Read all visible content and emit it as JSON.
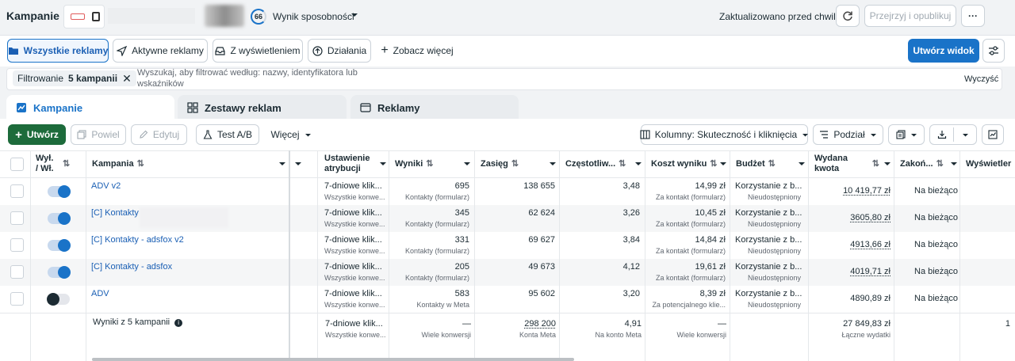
{
  "header": {
    "title": "Kampanie",
    "opportunity_score": "66",
    "opportunity_label": "Wynik sposobności",
    "updated": "Zaktualizowano przed chwilą",
    "review_publish": "Przejrzyj i opublikuj",
    "more": "···"
  },
  "quick_filters": {
    "all_ads": "Wszystkie reklamy",
    "active_ads": "Aktywne reklamy",
    "with_impressions": "Z wyświetleniem",
    "actions": "Działania",
    "see_more": "Zobacz więcej",
    "create_view": "Utwórz widok"
  },
  "filter": {
    "chip_prefix": "Filtrowanie",
    "chip_value": "5 kampanii",
    "search_placeholder": "Wyszukaj, aby filtrować według: nazwy, identyfikatora lub wskaźników",
    "clear": "Wyczyść"
  },
  "tabs": [
    "Kampanie",
    "Zestawy reklam",
    "Reklamy"
  ],
  "toolbar": {
    "create": "Utwórz",
    "duplicate": "Powiel",
    "edit": "Edytuj",
    "ab_test": "Test A/B",
    "more": "Więcej",
    "columns": "Kolumny: Skuteczność i kliknięcia",
    "breakdown": "Podział"
  },
  "columns": {
    "onoff": "Wył. / Wł.",
    "campaign": "Kampania",
    "attribution": "Ustawienie atrybucji",
    "results": "Wyniki",
    "reach": "Zasięg",
    "frequency": "Częstotliw...",
    "cost_per_result": "Koszt wyniku",
    "budget": "Budżet",
    "amount_spent": "Wydana kwota",
    "ends": "Zakoń...",
    "impressions": "Wyświetler"
  },
  "rows": [
    {
      "on": true,
      "name": "ADV v2",
      "attr": "7-dniowe klik...",
      "attr_sub": "Wszystkie konwe...",
      "results": "695",
      "results_sub": "Kontakty (formularz)",
      "reach": "138 655",
      "freq": "3,48",
      "cpr": "14,99 zł",
      "cpr_sub": "Za kontakt (formularz)",
      "budget": "Korzystanie z b...",
      "budget_sub": "Nieudostępniony",
      "spent": "10 419,77 zł",
      "ends": "Na bieżąco"
    },
    {
      "on": true,
      "name": "[C] Kontakty",
      "attr": "7-dniowe klik...",
      "attr_sub": "Wszystkie konwe...",
      "results": "345",
      "results_sub": "Kontakty (formularz)",
      "reach": "62 624",
      "freq": "3,26",
      "cpr": "10,45 zł",
      "cpr_sub": "Za kontakt (formularz)",
      "budget": "Korzystanie z b...",
      "budget_sub": "Nieudostępniony",
      "spent": "3605,80 zł",
      "ends": "Na bieżąco"
    },
    {
      "on": true,
      "name": "[C] Kontakty - adsfox v2",
      "attr": "7-dniowe klik...",
      "attr_sub": "Wszystkie konwe...",
      "results": "331",
      "results_sub": "Kontakty (formularz)",
      "reach": "69 627",
      "freq": "3,84",
      "cpr": "14,84 zł",
      "cpr_sub": "Za kontakt (formularz)",
      "budget": "Korzystanie z b...",
      "budget_sub": "Nieudostępniony",
      "spent": "4913,66 zł",
      "ends": "Na bieżąco"
    },
    {
      "on": true,
      "name": "[C] Kontakty - adsfox",
      "attr": "7-dniowe klik...",
      "attr_sub": "Wszystkie konwe...",
      "results": "205",
      "results_sub": "Kontakty (formularz)",
      "reach": "49 673",
      "freq": "4,12",
      "cpr": "19,61 zł",
      "cpr_sub": "Za kontakt (formularz)",
      "budget": "Korzystanie z b...",
      "budget_sub": "Nieudostępniony",
      "spent": "4019,71 zł",
      "ends": "Na bieżąco"
    },
    {
      "on": false,
      "name": "ADV",
      "attr": "7-dniowe klik...",
      "attr_sub": "Wszystkie konwe...",
      "results": "583",
      "results_sub": "Kontakty w Meta",
      "reach": "95 602",
      "freq": "3,20",
      "cpr": "8,39 zł",
      "cpr_sub": "Za potencjalnego klie...",
      "budget": "Korzystanie z b...",
      "budget_sub": "Nieudostępniony",
      "spent": "4890,89 zł",
      "ends": "Na bieżąco"
    }
  ],
  "summary": {
    "label": "Wyniki z 5 kampanii",
    "attr": "7-dniowe klik...",
    "attr_sub": "Wszystkie konwe...",
    "results": "—",
    "results_sub": "Wiele konwersji",
    "reach": "298 200",
    "reach_sub": "Konta Meta",
    "freq": "4,91",
    "freq_sub": "Na konto Meta",
    "cpr": "—",
    "cpr_sub": "Wiele konwersji",
    "spent": "27 849,83 zł",
    "spent_sub": "Łączne wydatki",
    "impressions_partial": "1"
  },
  "colors": {
    "accent": "#1a73c8",
    "create_green": "#1d6b3b",
    "link": "#1a5fb4"
  }
}
